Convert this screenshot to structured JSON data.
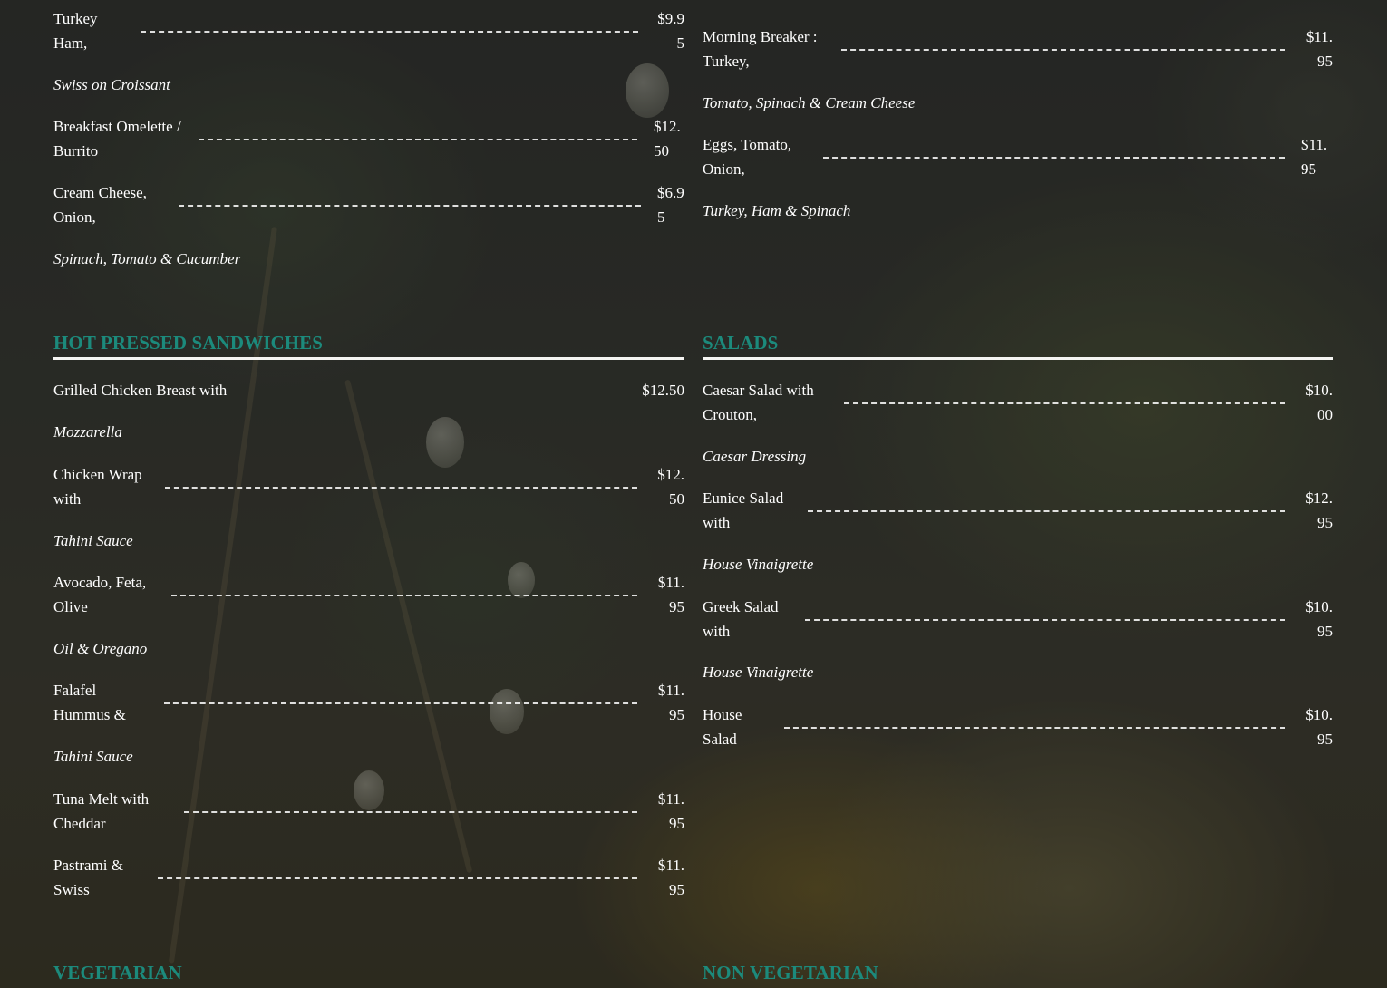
{
  "colors": {
    "section_heading": "#1c8a7c",
    "text": "#ffffff",
    "rule": "#f4f4f2"
  },
  "breakfast_left": {
    "items": [
      {
        "name": "Turkey Ham,",
        "price": "$9.95",
        "desc": "Swiss on Croissant"
      },
      {
        "name": "Breakfast Omelette / Burrito",
        "price": "$12.50",
        "desc": ""
      },
      {
        "name": "Cream Cheese, Onion,",
        "price": "$6.95",
        "desc": "Spinach, Tomato & Cucumber"
      }
    ]
  },
  "breakfast_right": {
    "items": [
      {
        "name": "Morning Breaker : Turkey,",
        "price": "$11.95",
        "desc": "Tomato, Spinach & Cream Cheese"
      },
      {
        "name": "Eggs, Tomato, Onion,",
        "price": "$11.95",
        "desc": "Turkey, Ham & Spinach"
      }
    ]
  },
  "hot_pressed": {
    "title": "HOT PRESSED SANDWICHES",
    "items": [
      {
        "name": "Grilled Chicken Breast with",
        "price": "$12.50",
        "desc": "Mozzarella"
      },
      {
        "name": "Chicken Wrap with",
        "price": "$12.50",
        "desc": "Tahini Sauce"
      },
      {
        "name": "Avocado, Feta, Olive",
        "price": "$11.95",
        "desc": "Oil & Oregano"
      },
      {
        "name": "Falafel Hummus &",
        "price": "$11.95",
        "desc": "Tahini Sauce"
      },
      {
        "name": "Tuna Melt with Cheddar",
        "price": "$11.95",
        "desc": ""
      },
      {
        "name": "Pastrami & Swiss",
        "price": "$11.95",
        "desc": ""
      }
    ]
  },
  "salads": {
    "title": "SALADS",
    "items": [
      {
        "name": "Caesar Salad with Crouton,",
        "price": "$10.00",
        "desc": "Caesar Dressing"
      },
      {
        "name": "Eunice Salad with",
        "price": "$12.95",
        "desc": "House Vinaigrette"
      },
      {
        "name": "Greek Salad with",
        "price": "$10.95",
        "desc": "House Vinaigrette"
      },
      {
        "name": "House Salad",
        "price": "$10.95",
        "desc": ""
      }
    ]
  },
  "vegetarian": {
    "title": "VEGETARIAN"
  },
  "non_vegetarian": {
    "title": "NON VEGETARIAN"
  }
}
